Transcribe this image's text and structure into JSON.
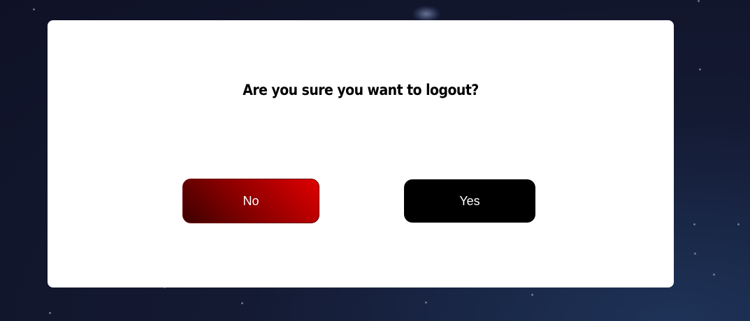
{
  "dialog": {
    "message": "Are you sure you want to logout?",
    "buttons": {
      "no_label": "No",
      "yes_label": "Yes"
    }
  },
  "colors": {
    "no_button_gradient": [
      "#3c0000",
      "#8a0000",
      "#e00000"
    ],
    "yes_button": "#000000",
    "backdrop": "#141a33"
  }
}
